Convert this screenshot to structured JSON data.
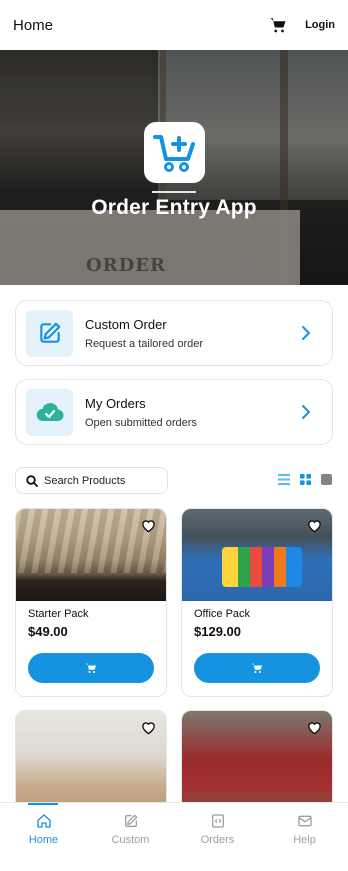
{
  "header": {
    "title": "Home",
    "login_label": "Login",
    "cart_icon": "cart-icon"
  },
  "hero": {
    "app_title": "Order Entry App",
    "background_text": "ORDER",
    "logo_icon": "cart-plus-icon"
  },
  "actions": [
    {
      "title": "Custom Order",
      "subtitle": "Request a tailored order",
      "icon": "edit-icon"
    },
    {
      "title": "My Orders",
      "subtitle": "Open submitted orders",
      "icon": "cloud-check-icon"
    }
  ],
  "search": {
    "placeholder": "Search Products"
  },
  "view_options": [
    "list-view-icon",
    "grid-view-icon",
    "tile-view-icon"
  ],
  "products": [
    {
      "name": "Starter Pack",
      "price": "$49.00"
    },
    {
      "name": "Office Pack",
      "price": "$129.00"
    },
    {
      "name": "",
      "price": ""
    },
    {
      "name": "",
      "price": ""
    }
  ],
  "nav": [
    {
      "label": "Home",
      "icon": "home-icon",
      "active": true
    },
    {
      "label": "Custom",
      "icon": "edit-icon",
      "active": false
    },
    {
      "label": "Orders",
      "icon": "orders-icon",
      "active": false
    },
    {
      "label": "Help",
      "icon": "mail-icon",
      "active": false
    }
  ],
  "colors": {
    "accent": "#1693e0",
    "icon_bg": "#e3f2fb",
    "muted": "#9aa0a6"
  }
}
